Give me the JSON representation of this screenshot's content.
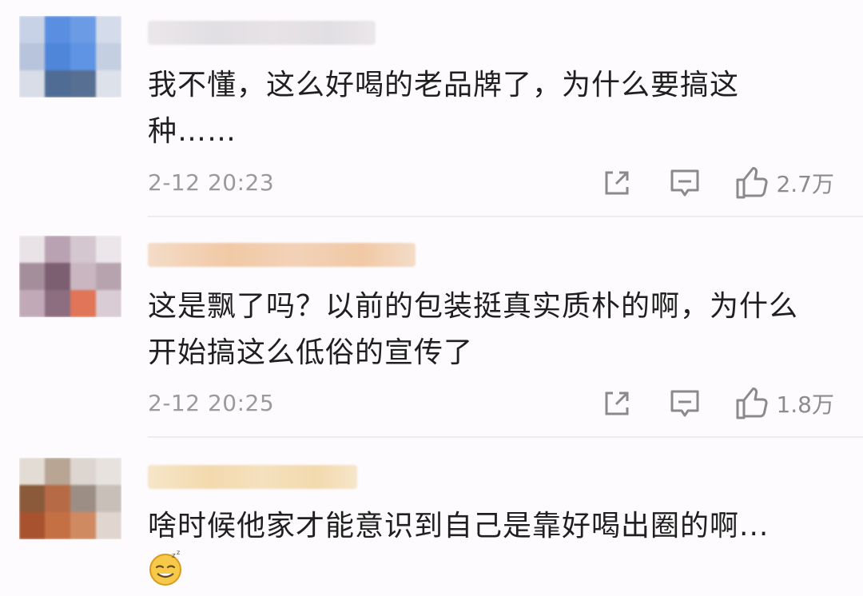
{
  "comments": [
    {
      "text_lines": [
        "我不懂，这么好喝的老品牌了，为什么要搞这",
        "种……"
      ],
      "time": "2-12 20:23",
      "likes": "2.7万",
      "avatar_colors": [
        "#c8d2e6",
        "#5a8ee0",
        "#6a9be4",
        "#d4dbea",
        "#b7c4db",
        "#4f86da",
        "#5e94e3",
        "#c5cfe2",
        "#d8dde7",
        "#4f6c94",
        "#566f92",
        "#dde1ea"
      ],
      "username_colors": [
        "#ebe7ea",
        "#e2dfe4",
        "#e7e3e6"
      ]
    },
    {
      "text_lines": [
        "这是飘了吗？以前的包装挺真实质朴的啊，为什么",
        "开始搞这么低俗的宣传了"
      ],
      "time": "2-12 20:25",
      "likes": "1.8万",
      "avatar_colors": [
        "#e9e3e7",
        "#b9a2b2",
        "#d4c7cf",
        "#ece6ea",
        "#a58e9c",
        "#7d5f72",
        "#c9b6c1",
        "#b7a3ae",
        "#c1a9b8",
        "#8c6e80",
        "#e07558",
        "#d9ccd4"
      ],
      "username_colors": [
        "#f4dcc8",
        "#f1c9a5",
        "#f2d2b7"
      ]
    },
    {
      "text_lines": [
        "啥时候他家才能意识到自己是靠好喝出圈的啊..."
      ],
      "avatar_colors": [
        "#e3dcd4",
        "#b8a594",
        "#ddd6d0",
        "#e7e2de",
        "#8a5a3a",
        "#b66b46",
        "#9d8e85",
        "#c8bfb9",
        "#a8522f",
        "#c56f44",
        "#d08a62",
        "#e0d6cf"
      ],
      "username_colors": [
        "#f6e6c9",
        "#f3d9ad",
        "#f5e1bf"
      ]
    }
  ]
}
